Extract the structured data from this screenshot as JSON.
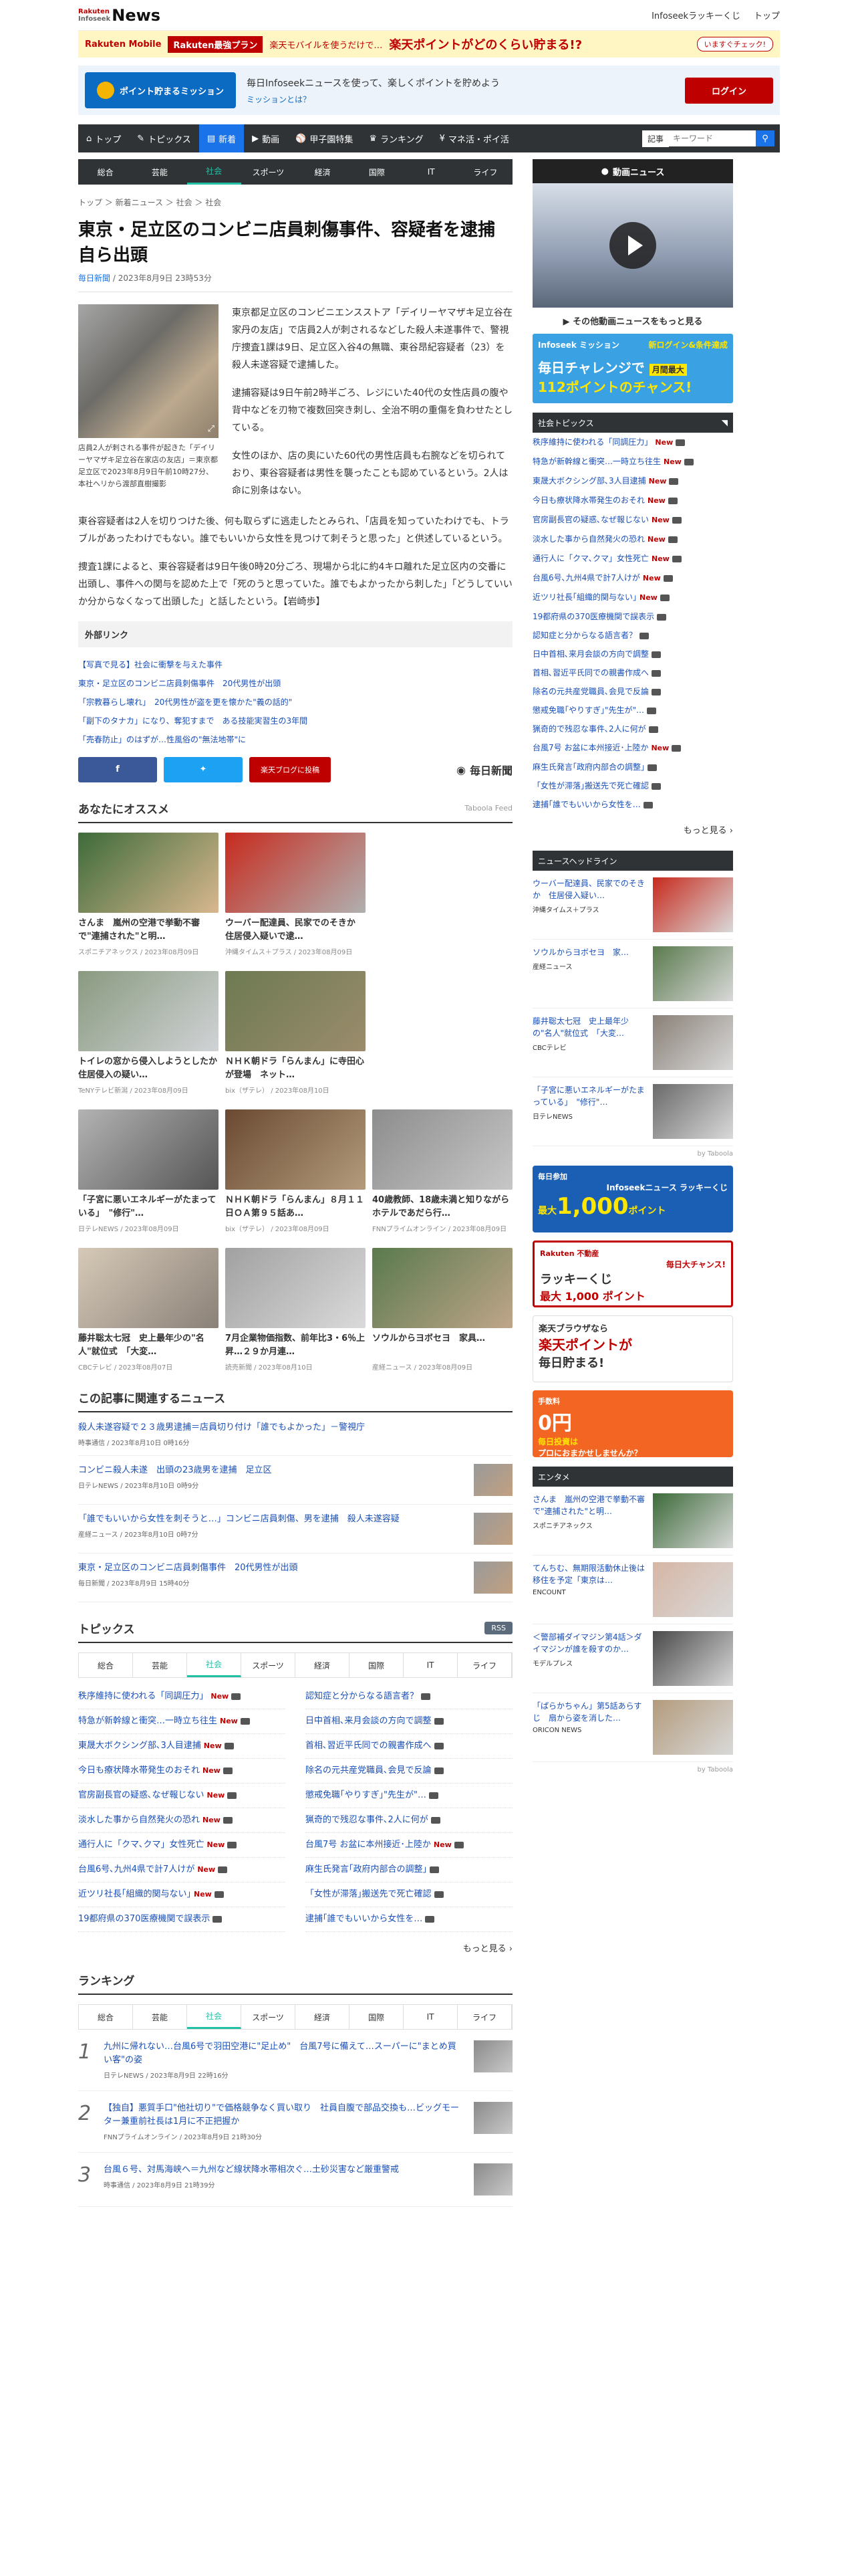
{
  "header": {
    "logo_small_1": "Rakuten",
    "logo_small_2": "Infoseek",
    "logo_big": "News",
    "lucky": "Infoseekラッキーくじ",
    "top": "トップ"
  },
  "adbar": {
    "mobile": "Rakuten Mobile",
    "plan": "Rakuten最強プラン",
    "text": "楽天モバイルを使うだけで…",
    "big": "楽天ポイントがどのくらい貯まる!?",
    "cta": "いますぐチェック!"
  },
  "mission": {
    "btn": "ポイント貯まるミッション",
    "text": "毎日Infoseekニュースを使って、楽しくポイントを貯めよう",
    "link": "ミッションとは？",
    "login": "ログイン"
  },
  "gnav": {
    "items": [
      "トップ",
      "トピックス",
      "新着",
      "動画",
      "甲子園特集",
      "ランキング",
      "マネ活・ポイ活"
    ],
    "select": "記事",
    "placeholder": "キーワード"
  },
  "subnav": [
    "総合",
    "芸能",
    "社会",
    "スポーツ",
    "経済",
    "国際",
    "IT",
    "ライフ"
  ],
  "breadcrumb": "トップ ＞ 新着ニュース ＞ 社会 ＞ 社会",
  "article": {
    "title": "東京・足立区のコンビニ店員刺傷事件、容疑者を逮捕　自ら出頭",
    "source": "毎日新聞",
    "date": " / 2023年8月9日 23時53分",
    "caption": "店員2人が刺される事件が起きた「デイリーヤマザキ足立谷在家店の友店」＝東京都足立区で2023年8月9日午前10時27分、本社ヘリから渡部直樹撮影",
    "p1": "東京都足立区のコンビニエンスストア「デイリーヤマザキ足立谷在家丹の友店」で店員2人が刺されるなどした殺人未遂事件で、警視庁捜査1課は9日、足立区入谷4の無職、東谷昂紀容疑者（23）を殺人未遂容疑で逮捕した。",
    "p2": "逮捕容疑は9日午前2時半ごろ、レジにいた40代の女性店員の腹や背中などを刃物で複数回突き刺し、全治不明の重傷を負わせたとしている。",
    "p3": "女性のほか、店の奥にいた60代の男性店員も右腕などを切られており、東谷容疑者は男性を襲ったことも認めているという。2人は命に別条はない。",
    "p4": "東谷容疑者は2人を切りつけた後、何も取らずに逃走したとみられ、「店員を知っていたわけでも、トラブルがあったわけでもない。誰でもいいから女性を見つけて刺そうと思った」と供述しているという。",
    "p5": "捜査1課によると、東谷容疑者は9日午後0時20分ごろ、現場から北に約4キロ離れた足立区内の交番に出頭し、事件への関与を認めた上で「死のうと思っていた。誰でもよかったから刺した」「どうしていいか分からなくなって出頭した」と話したという。【岩崎歩】"
  },
  "external": {
    "title": "外部リンク",
    "links": [
      "【写真で見る】社会に衝撃を与えた事件",
      "東京・足立区のコンビニ店員刺傷事件　20代男性が出頭",
      "「宗教暮らし壊れ」　20代男性が盗を更を懐かた\"義の話的\"",
      "「副下のタナカ」になり、奪犯すまで　ある技能実習生の3年間",
      "「売春防止」のはずが…性風俗の\"無法地帯\"に"
    ]
  },
  "share": {
    "rakuten": "楽天ブログに投稿",
    "mainichi": "毎日新聞"
  },
  "recommend": {
    "title": "あなたにオススメ",
    "feed": "Taboola Feed",
    "cards": [
      {
        "t": "さんま　嵐州の空港で挙動不審で\"連捕された\"と明…",
        "s": "スポニチアネックス / 2023年08月09日",
        "c1": "#3d6b3a",
        "c2": "#d9b78f"
      },
      {
        "t": "ウーバー配達員、民家でのそきか　住居侵入疑いで逮…",
        "s": "沖縄タイムス＋プラス / 2023年08月09日",
        "c1": "#c72a1d",
        "c2": "#b0b0b0"
      },
      {
        "t": "",
        "s": "",
        "c1": "#fff",
        "c2": "#fff"
      },
      {
        "t": "トイレの窓から侵入しようとしたか　住居侵入の疑い…",
        "s": "TeNYテレビ新潟 / 2023年08月09日",
        "c1": "#8a9a80",
        "c2": "#d0d3d6"
      },
      {
        "t": "ＮＨＫ朝ドラ「らんまん」に寺田心が登場　ネット…",
        "s": "bix（ザテレ） / 2023年08月10日",
        "c1": "#6d7a52",
        "c2": "#9b8c6c"
      },
      {
        "t": "",
        "s": "",
        "c1": "#fff",
        "c2": "#fff"
      },
      {
        "t": "「子宮に悪いエネルギーがたまっている」　\"修行\"…",
        "s": "日テレNEWS / 2023年08月09日",
        "c1": "#b3b3b3",
        "c2": "#555"
      },
      {
        "t": "ＮＨＫ朝ドラ「らんまん」８月１１日ＯＡ第９５話あ…",
        "s": "bix（ザテレ） / 2023年08月09日",
        "c1": "#6a4a32",
        "c2": "#b39b7c"
      },
      {
        "t": "40歳教師、18歳未満と知りながらホテルであだら行…",
        "s": "FNNプライムオンライン / 2023年08月09日",
        "c1": "#8d8d8d",
        "c2": "#c7c7c7"
      },
      {
        "t": "藤井聡太七冠　史上最年少の\"名人\"就位式　「大変…",
        "s": "CBCテレビ / 2023年08月07日",
        "c1": "#d6c9b7",
        "c2": "#8a8178"
      },
      {
        "t": "7月企業物価指数、前年比3・6％上昇…２９か月連…",
        "s": "読売新聞 / 2023年08月10日",
        "c1": "#a1a1a1",
        "c2": "#dadada"
      },
      {
        "t": "ソウルからヨボセヨ　家具…",
        "s": "産経ニュース / 2023年08月09日",
        "c1": "#5a7a4d",
        "c2": "#bfa58a"
      }
    ]
  },
  "related": {
    "title": "この記事に関連するニュース",
    "items": [
      {
        "t": "殺人未遂容疑で２３歳男逮捕＝店員切り付け「誰でもよかった」－警視庁",
        "s": "時事通信 / 2023年8月10日 0時16分",
        "th": false
      },
      {
        "t": "コンビニ殺人未遂　出頭の23歳男を逮捕　足立区",
        "s": "日テレNEWS / 2023年8月10日 0時9分",
        "th": true
      },
      {
        "t": "「誰でもいいから女性を刺そうと…」コンビニ店員刺傷、男を逮捕　殺人未遂容疑",
        "s": "産経ニュース / 2023年8月10日 0時7分",
        "th": true
      },
      {
        "t": "東京・足立区のコンビニ店員刺傷事件　20代男性が出頭",
        "s": "毎日新聞 / 2023年8月9日 15時40分",
        "th": true
      }
    ]
  },
  "topics": {
    "title": "トピックス",
    "rss": "RSS",
    "tabs": [
      "総合",
      "芸能",
      "社会",
      "スポーツ",
      "経済",
      "国際",
      "IT",
      "ライフ"
    ],
    "left": [
      [
        "秩序維持に使われる「同調圧力」",
        true
      ],
      [
        "特急が新幹線と衝突…一時立ち往生",
        true
      ],
      [
        "東晟大ボクシング部､3人目逮捕",
        true
      ],
      [
        "今日も療状降水帯発生のおそれ",
        true
      ],
      [
        "官房副長官の疑惑､なぜ報じない",
        true
      ],
      [
        "淡水した事から自然発火の恐れ",
        true
      ],
      [
        "通行人に「クマ､クマ」女性死亡",
        true
      ],
      [
        "台風6号､九州4県で計7人けが",
        true
      ],
      [
        "近ツリ社長｢組織的関与ない｣",
        true
      ],
      [
        "19都府県の370医療機関で誤表示",
        false
      ]
    ],
    "right": [
      [
        "認知症と分からなる語言者？",
        false
      ],
      [
        "日中首相､来月会談の方向で調整",
        false
      ],
      [
        "首相､習近平氏同での親書作成へ",
        false
      ],
      [
        "除名の元共産党職員､会見で反論",
        false
      ],
      [
        "懲戒免職｢やりすぎ｣\"先生が\"…",
        false
      ],
      [
        "猟奇的で残忍な事件､2人に何が",
        false
      ],
      [
        "台風7号 お盆に本州接近･上陸か",
        true
      ],
      [
        "麻生氏発言｢政府内部合の調整｣",
        false
      ],
      [
        "「女性が滞落｣搬送先で死亡確認",
        false
      ],
      [
        "逮捕｢誰でもいいから女性を…",
        false
      ]
    ],
    "more": "もっと見る"
  },
  "ranking": {
    "title": "ランキング",
    "tabs": [
      "総合",
      "芸能",
      "社会",
      "スポーツ",
      "経済",
      "国際",
      "IT",
      "ライフ"
    ],
    "items": [
      {
        "n": "1",
        "t": "九州に帰れない…台風6号で羽田空港に\"足止め\"　台風7号に備えて…スーパーに\"まとめ買い客\"の姿",
        "s": "日テレNEWS / 2023年8月9日 22時16分"
      },
      {
        "n": "2",
        "t": "【独自】悪質手口\"他社切り\"で価格競争なく買い取り　社員自腹で部品交換も…ビッグモーター兼重前社長は1月に不正把握か",
        "s": "FNNプライムオンライン / 2023年8月9日 21時30分"
      },
      {
        "n": "3",
        "t": "台風６号、対馬海峡へ＝九州など線状降水帯相次ぐ…土砂災害など厳重警戒",
        "s": "時事通信 / 2023年8月9日 21時39分"
      }
    ]
  },
  "side": {
    "video_title": "動画ニュース",
    "video_more": "その他動画ニュースをもっと見る",
    "ad": {
      "brand": "Infoseek ミッション",
      "note": "新ログイン&条件達成",
      "line1": "毎日チャレンジで",
      "line2": "112ポイントのチャンス!",
      "tag": "月間最大"
    },
    "topics_title": "社会トピックス",
    "topics": [
      [
        "秩序維持に使われる「同調圧力」",
        true
      ],
      [
        "特急が新幹線と衝突…一時立ち往生",
        true
      ],
      [
        "東晟大ボクシング部､3人目逮捕",
        true
      ],
      [
        "今日も療状降水帯発生のおそれ",
        true
      ],
      [
        "官房副長官の疑惑､なぜ報じない",
        true
      ],
      [
        "淡水した事から自然発火の恐れ",
        true
      ],
      [
        "通行人に「クマ､クマ」女性死亡",
        true
      ],
      [
        "台風6号､九州4県で計7人けが",
        true
      ],
      [
        "近ツリ社長｢組織的関与ない｣",
        true
      ],
      [
        "19都府県の370医療機関で誤表示",
        false
      ],
      [
        "認知症と分からなる語言者？",
        false
      ],
      [
        "日中首相､来月会談の方向で調整",
        false
      ],
      [
        "首相､習近平氏同での親書作成へ",
        false
      ],
      [
        "除名の元共産党職員､会見で反論",
        false
      ],
      [
        "懲戒免職｢やりすぎ｣\"先生が\"…",
        false
      ],
      [
        "猟奇的で残忍な事件､2人に何が",
        false
      ],
      [
        "台風7号 お盆に本州接近･上陸か",
        true
      ],
      [
        "麻生氏発言｢政府内部合の調整｣",
        false
      ],
      [
        "「女性が滞落｣搬送先で死亡確認",
        false
      ],
      [
        "逮捕｢誰でもいいから女性を…",
        false
      ]
    ],
    "topics_more": "もっと見る",
    "headline_title": "ニュースヘッドライン",
    "headlines": [
      {
        "t": "ウーバー配達員、民家でのそきか　住居侵入疑い…",
        "s": "沖縄タイムス＋プラス",
        "c": "#c72a1d"
      },
      {
        "t": "ソウルからヨボセヨ　家…",
        "s": "産経ニュース",
        "c": "#5a7a4d"
      },
      {
        "t": "藤井聡太七冠　史上最年少の\"名人\"就位式　「大変…",
        "s": "CBCテレビ",
        "c": "#8a8178"
      },
      {
        "t": "「子宮に悪いエネルギーがたまっている」　\"修行\"…",
        "s": "日テレNEWS",
        "c": "#6a6a6a"
      }
    ],
    "taboola": "by Taboola",
    "b1": {
      "a": "毎日参加",
      "b": "Infoseekニュース ラッキーくじ",
      "c": "最大",
      "d": "1,000",
      "e": "ポイント"
    },
    "b2": {
      "a": "Rakuten 不動産",
      "b": "毎日大チャンス!",
      "c": "ラッキーくじ",
      "d": "最大 1,000 ポイント"
    },
    "b3": {
      "a": "楽天ブラウザなら",
      "b": "楽天ポイントが",
      "c": "毎日貯まる!"
    },
    "b4": {
      "a": "手数料",
      "b": "0円",
      "c": "毎日投資は",
      "d": "プロにおまかせしませんか？"
    },
    "enta_title": "エンタメ",
    "enta": [
      {
        "t": "さんま　嵐州の空港で挙動不審で\"連捕された\"と明…",
        "s": "スポニチアネックス",
        "c": "#3d6b3a"
      },
      {
        "t": "てんちむ、無期限活動休止後は移住を予定「東京は…",
        "s": "ENCOUNT",
        "c": "#d6b6a5"
      },
      {
        "t": "＜警部補ダイマジン第4話＞ダイマジンが誰を殺すのか…",
        "s": "モデルプレス",
        "c": "#4a4a4a"
      },
      {
        "t": "「ぱらかちゃん」第5話あらすじ　扇から姿を消した…",
        "s": "ORICON NEWS",
        "c": "#b39b7c"
      }
    ]
  }
}
